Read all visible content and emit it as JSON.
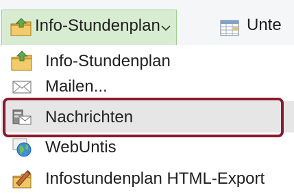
{
  "toolbar": {
    "info_button_label": "Info-Stundenplan",
    "second_button_label": "Unte"
  },
  "menu": {
    "items": [
      {
        "label": "Info-Stundenplan",
        "icon": "folder-upload-icon"
      },
      {
        "label": "Mailen...",
        "icon": "envelope-icon"
      },
      {
        "label": "Nachrichten",
        "icon": "message-board-icon"
      },
      {
        "label": "WebUntis",
        "icon": "globe-web-icon"
      },
      {
        "label": "Infostundenplan HTML-Export",
        "icon": "html-export-icon"
      }
    ],
    "highlighted_index": 2
  },
  "colors": {
    "active_button_bg": "#d7ecd0",
    "highlight_frame": "#8b1a2e"
  }
}
